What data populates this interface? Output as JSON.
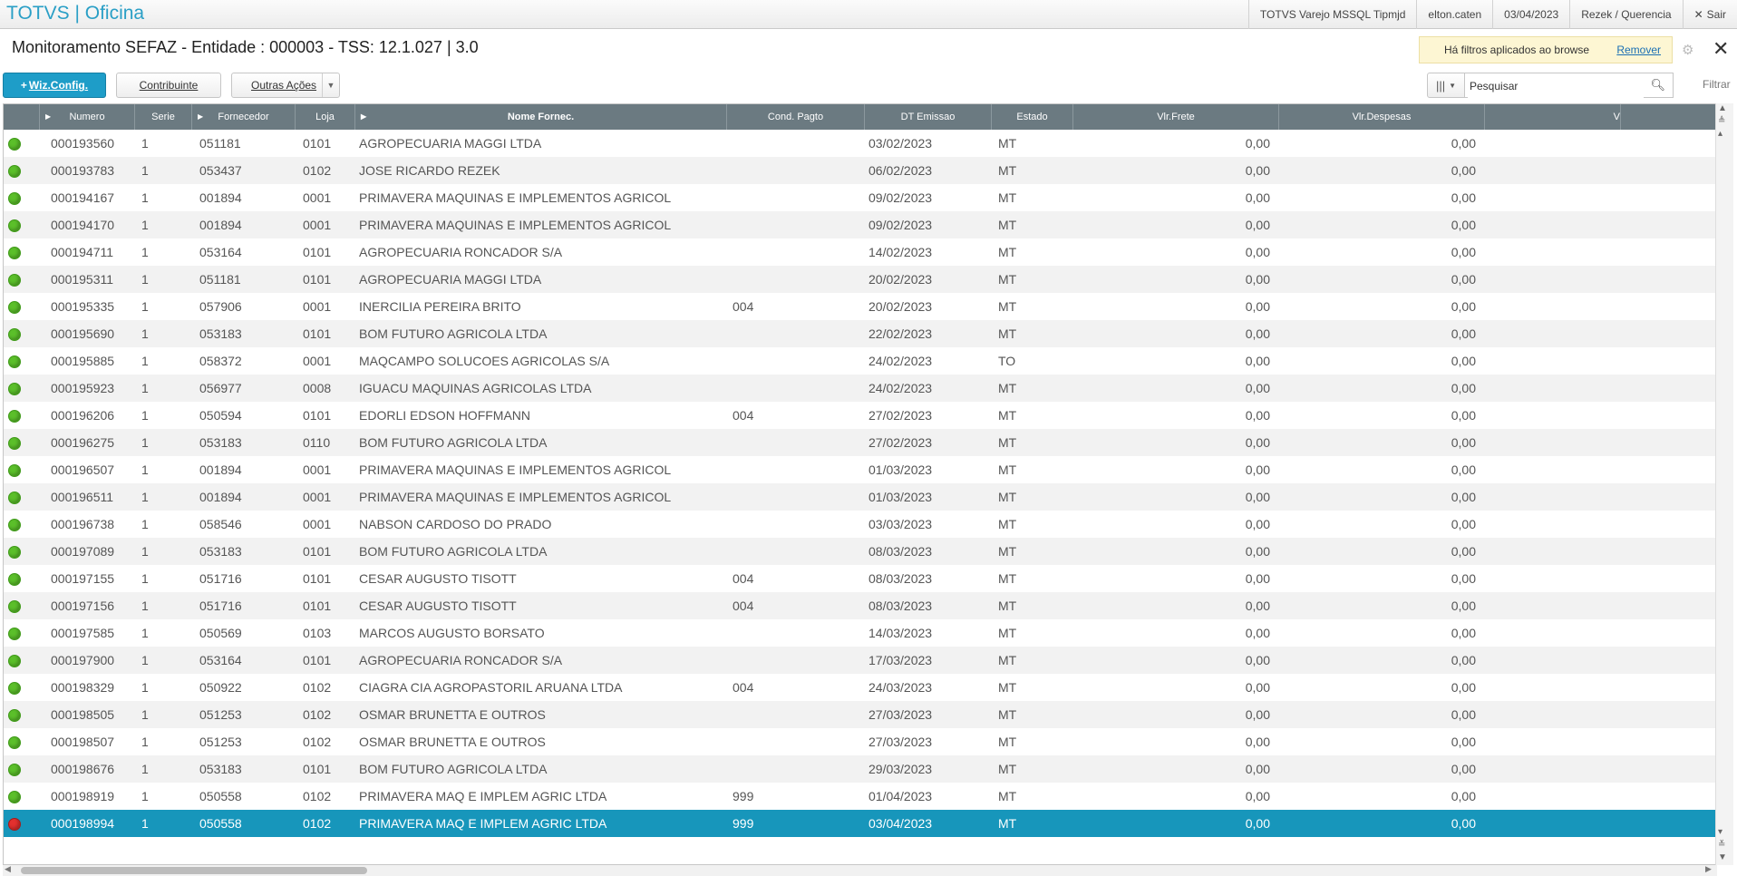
{
  "app": {
    "brand": "TOTVS | Oficina",
    "environment": "TOTVS Varejo MSSQL Tipmjd",
    "user": "elton.caten",
    "date": "03/04/2023",
    "branch": "Rezek / Querencia",
    "exit_label": "Sair"
  },
  "header": {
    "title": "Monitoramento SEFAZ - Entidade : 000003 - TSS: 12.1.027 | 3.0",
    "filter_notice": "Há filtros aplicados ao browse",
    "filter_remove": "Remover"
  },
  "toolbar": {
    "wiz_label": "Wiz.Config.",
    "contribuinte_label": "Contribuinte",
    "outras_label": "Outras Ações",
    "search_placeholder": "Pesquisar",
    "filtrar_label": "Filtrar"
  },
  "grid": {
    "columns": [
      "",
      "Numero",
      "Serie",
      "Fornecedor",
      "Loja",
      "Nome Fornec.",
      "Cond. Pagto",
      "DT Emissao",
      "Estado",
      "Vlr.Frete",
      "Vlr.Despesas",
      "V"
    ],
    "rows": [
      {
        "status": "green",
        "numero": "000193560",
        "serie": "1",
        "fornecedor": "051181",
        "loja": "0101",
        "nome": "AGROPECUARIA MAGGI LTDA",
        "cond": "",
        "dt": "03/02/2023",
        "estado": "MT",
        "frete": "0,00",
        "despesas": "0,00"
      },
      {
        "status": "green",
        "numero": "000193783",
        "serie": "1",
        "fornecedor": "053437",
        "loja": "0102",
        "nome": "JOSE RICARDO REZEK",
        "cond": "",
        "dt": "06/02/2023",
        "estado": "MT",
        "frete": "0,00",
        "despesas": "0,00"
      },
      {
        "status": "green",
        "numero": "000194167",
        "serie": "1",
        "fornecedor": "001894",
        "loja": "0001",
        "nome": "PRIMAVERA MAQUINAS E IMPLEMENTOS AGRICOL",
        "cond": "",
        "dt": "09/02/2023",
        "estado": "MT",
        "frete": "0,00",
        "despesas": "0,00"
      },
      {
        "status": "green",
        "numero": "000194170",
        "serie": "1",
        "fornecedor": "001894",
        "loja": "0001",
        "nome": "PRIMAVERA MAQUINAS E IMPLEMENTOS AGRICOL",
        "cond": "",
        "dt": "09/02/2023",
        "estado": "MT",
        "frete": "0,00",
        "despesas": "0,00"
      },
      {
        "status": "green",
        "numero": "000194711",
        "serie": "1",
        "fornecedor": "053164",
        "loja": "0101",
        "nome": "AGROPECUARIA RONCADOR S/A",
        "cond": "",
        "dt": "14/02/2023",
        "estado": "MT",
        "frete": "0,00",
        "despesas": "0,00"
      },
      {
        "status": "green",
        "numero": "000195311",
        "serie": "1",
        "fornecedor": "051181",
        "loja": "0101",
        "nome": "AGROPECUARIA MAGGI LTDA",
        "cond": "",
        "dt": "20/02/2023",
        "estado": "MT",
        "frete": "0,00",
        "despesas": "0,00"
      },
      {
        "status": "green",
        "numero": "000195335",
        "serie": "1",
        "fornecedor": "057906",
        "loja": "0001",
        "nome": "INERCILIA PEREIRA BRITO",
        "cond": "004",
        "dt": "20/02/2023",
        "estado": "MT",
        "frete": "0,00",
        "despesas": "0,00"
      },
      {
        "status": "green",
        "numero": "000195690",
        "serie": "1",
        "fornecedor": "053183",
        "loja": "0101",
        "nome": "BOM FUTURO AGRICOLA LTDA",
        "cond": "",
        "dt": "22/02/2023",
        "estado": "MT",
        "frete": "0,00",
        "despesas": "0,00"
      },
      {
        "status": "green",
        "numero": "000195885",
        "serie": "1",
        "fornecedor": "058372",
        "loja": "0001",
        "nome": "MAQCAMPO SOLUCOES AGRICOLAS S/A",
        "cond": "",
        "dt": "24/02/2023",
        "estado": "TO",
        "frete": "0,00",
        "despesas": "0,00"
      },
      {
        "status": "green",
        "numero": "000195923",
        "serie": "1",
        "fornecedor": "056977",
        "loja": "0008",
        "nome": "IGUACU MAQUINAS AGRICOLAS LTDA",
        "cond": "",
        "dt": "24/02/2023",
        "estado": "MT",
        "frete": "0,00",
        "despesas": "0,00"
      },
      {
        "status": "green",
        "numero": "000196206",
        "serie": "1",
        "fornecedor": "050594",
        "loja": "0101",
        "nome": "EDORLI EDSON HOFFMANN",
        "cond": "004",
        "dt": "27/02/2023",
        "estado": "MT",
        "frete": "0,00",
        "despesas": "0,00"
      },
      {
        "status": "green",
        "numero": "000196275",
        "serie": "1",
        "fornecedor": "053183",
        "loja": "0110",
        "nome": "BOM FUTURO AGRICOLA LTDA",
        "cond": "",
        "dt": "27/02/2023",
        "estado": "MT",
        "frete": "0,00",
        "despesas": "0,00"
      },
      {
        "status": "green",
        "numero": "000196507",
        "serie": "1",
        "fornecedor": "001894",
        "loja": "0001",
        "nome": "PRIMAVERA MAQUINAS E IMPLEMENTOS AGRICOL",
        "cond": "",
        "dt": "01/03/2023",
        "estado": "MT",
        "frete": "0,00",
        "despesas": "0,00"
      },
      {
        "status": "green",
        "numero": "000196511",
        "serie": "1",
        "fornecedor": "001894",
        "loja": "0001",
        "nome": "PRIMAVERA MAQUINAS E IMPLEMENTOS AGRICOL",
        "cond": "",
        "dt": "01/03/2023",
        "estado": "MT",
        "frete": "0,00",
        "despesas": "0,00"
      },
      {
        "status": "green",
        "numero": "000196738",
        "serie": "1",
        "fornecedor": "058546",
        "loja": "0001",
        "nome": "NABSON CARDOSO DO PRADO",
        "cond": "",
        "dt": "03/03/2023",
        "estado": "MT",
        "frete": "0,00",
        "despesas": "0,00"
      },
      {
        "status": "green",
        "numero": "000197089",
        "serie": "1",
        "fornecedor": "053183",
        "loja": "0101",
        "nome": "BOM FUTURO AGRICOLA LTDA",
        "cond": "",
        "dt": "08/03/2023",
        "estado": "MT",
        "frete": "0,00",
        "despesas": "0,00"
      },
      {
        "status": "green",
        "numero": "000197155",
        "serie": "1",
        "fornecedor": "051716",
        "loja": "0101",
        "nome": "CESAR AUGUSTO TISOTT",
        "cond": "004",
        "dt": "08/03/2023",
        "estado": "MT",
        "frete": "0,00",
        "despesas": "0,00"
      },
      {
        "status": "green",
        "numero": "000197156",
        "serie": "1",
        "fornecedor": "051716",
        "loja": "0101",
        "nome": "CESAR AUGUSTO TISOTT",
        "cond": "004",
        "dt": "08/03/2023",
        "estado": "MT",
        "frete": "0,00",
        "despesas": "0,00"
      },
      {
        "status": "green",
        "numero": "000197585",
        "serie": "1",
        "fornecedor": "050569",
        "loja": "0103",
        "nome": "MARCOS AUGUSTO BORSATO",
        "cond": "",
        "dt": "14/03/2023",
        "estado": "MT",
        "frete": "0,00",
        "despesas": "0,00"
      },
      {
        "status": "green",
        "numero": "000197900",
        "serie": "1",
        "fornecedor": "053164",
        "loja": "0101",
        "nome": "AGROPECUARIA RONCADOR S/A",
        "cond": "",
        "dt": "17/03/2023",
        "estado": "MT",
        "frete": "0,00",
        "despesas": "0,00"
      },
      {
        "status": "green",
        "numero": "000198329",
        "serie": "1",
        "fornecedor": "050922",
        "loja": "0102",
        "nome": "CIAGRA CIA AGROPASTORIL ARUANA LTDA",
        "cond": "004",
        "dt": "24/03/2023",
        "estado": "MT",
        "frete": "0,00",
        "despesas": "0,00"
      },
      {
        "status": "green",
        "numero": "000198505",
        "serie": "1",
        "fornecedor": "051253",
        "loja": "0102",
        "nome": "OSMAR BRUNETTA E OUTROS",
        "cond": "",
        "dt": "27/03/2023",
        "estado": "MT",
        "frete": "0,00",
        "despesas": "0,00"
      },
      {
        "status": "green",
        "numero": "000198507",
        "serie": "1",
        "fornecedor": "051253",
        "loja": "0102",
        "nome": "OSMAR BRUNETTA E OUTROS",
        "cond": "",
        "dt": "27/03/2023",
        "estado": "MT",
        "frete": "0,00",
        "despesas": "0,00"
      },
      {
        "status": "green",
        "numero": "000198676",
        "serie": "1",
        "fornecedor": "053183",
        "loja": "0101",
        "nome": "BOM FUTURO AGRICOLA LTDA",
        "cond": "",
        "dt": "29/03/2023",
        "estado": "MT",
        "frete": "0,00",
        "despesas": "0,00"
      },
      {
        "status": "green",
        "numero": "000198919",
        "serie": "1",
        "fornecedor": "050558",
        "loja": "0102",
        "nome": "PRIMAVERA MAQ E IMPLEM AGRIC LTDA",
        "cond": "999",
        "dt": "01/04/2023",
        "estado": "MT",
        "frete": "0,00",
        "despesas": "0,00"
      },
      {
        "status": "red",
        "numero": "000198994",
        "serie": "1",
        "fornecedor": "050558",
        "loja": "0102",
        "nome": "PRIMAVERA MAQ E IMPLEM AGRIC LTDA",
        "cond": "999",
        "dt": "03/04/2023",
        "estado": "MT",
        "frete": "0,00",
        "despesas": "0,00",
        "selected": true
      }
    ]
  },
  "colors": {
    "brand": "#2a9fc6",
    "selected_row": "#1796bb",
    "header_bg": "#6b7a81",
    "status_green": "#5bbf2a",
    "status_red": "#e3302e"
  }
}
